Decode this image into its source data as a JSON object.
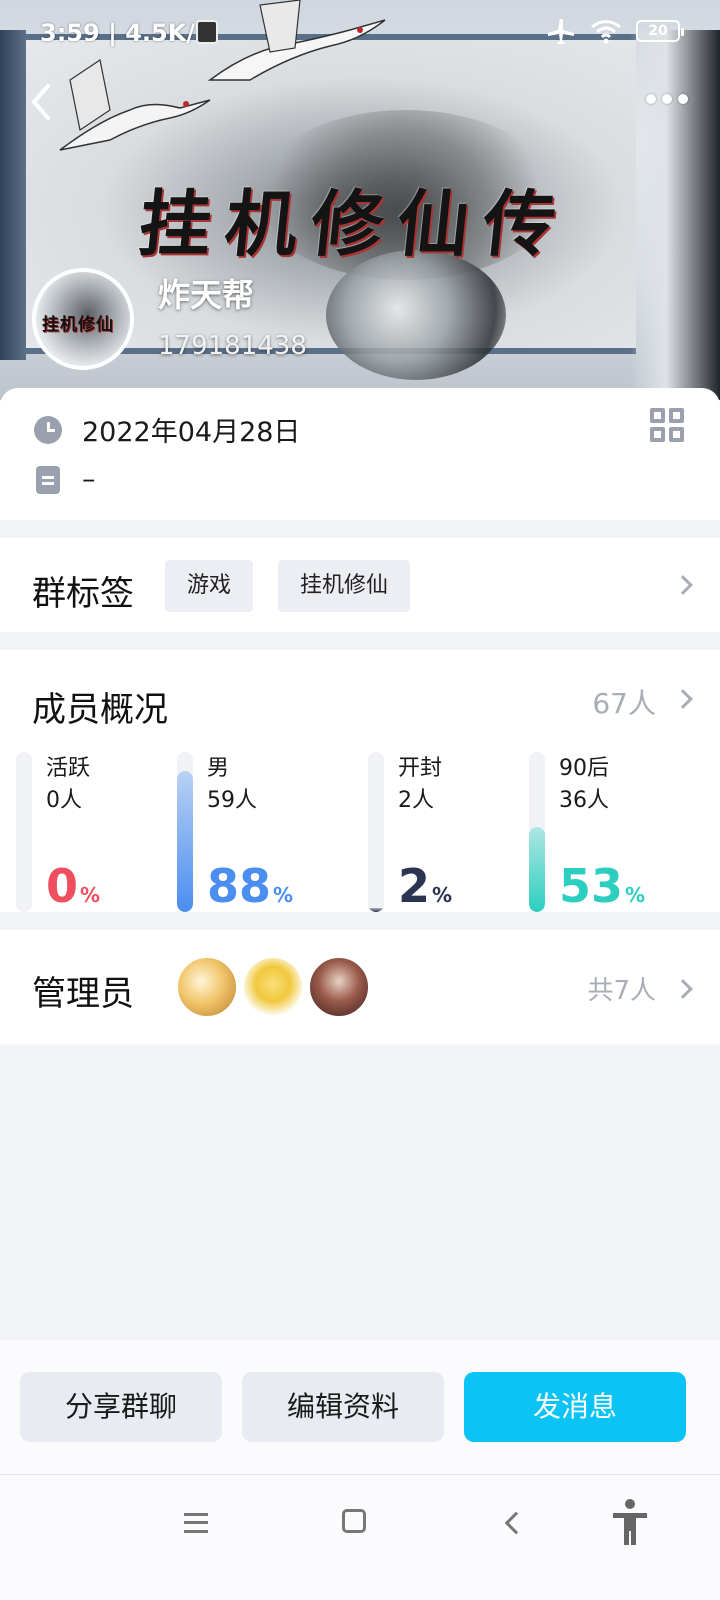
{
  "status_bar": {
    "time": "3:59",
    "speed": "4.5K/s",
    "battery": "20"
  },
  "banner": {
    "title": "挂机修仙传"
  },
  "group": {
    "name": "炸天帮",
    "id": "179181438",
    "avatar_title": "挂机修仙"
  },
  "info": {
    "created_date": "2022年04月28日",
    "description": "–"
  },
  "tags": {
    "title": "群标签",
    "items": [
      "游戏",
      "挂机修仙"
    ]
  },
  "members": {
    "title": "成员概况",
    "total": "67人",
    "stats": [
      {
        "label": "活跃",
        "count": "0人",
        "percent": 0,
        "percent_text": "0",
        "color": "#ee4e5e"
      },
      {
        "label": "男",
        "count": "59人",
        "percent": 88,
        "percent_text": "88",
        "color": "#4a8ef0"
      },
      {
        "label": "开封",
        "count": "2人",
        "percent": 2,
        "percent_text": "2",
        "color": "#2b3450"
      },
      {
        "label": "90后",
        "count": "36人",
        "percent": 53,
        "percent_text": "53",
        "color": "#2ccfbf"
      }
    ],
    "percent_symbol": "%"
  },
  "admins": {
    "title": "管理员",
    "total": "共7人"
  },
  "actions": {
    "share": "分享群聊",
    "edit": "编辑资料",
    "message": "发消息"
  },
  "colors": {
    "primary": "#0bc3f5",
    "secondary_button": "#e9ebf2",
    "page_background": "#f3f4f8"
  }
}
